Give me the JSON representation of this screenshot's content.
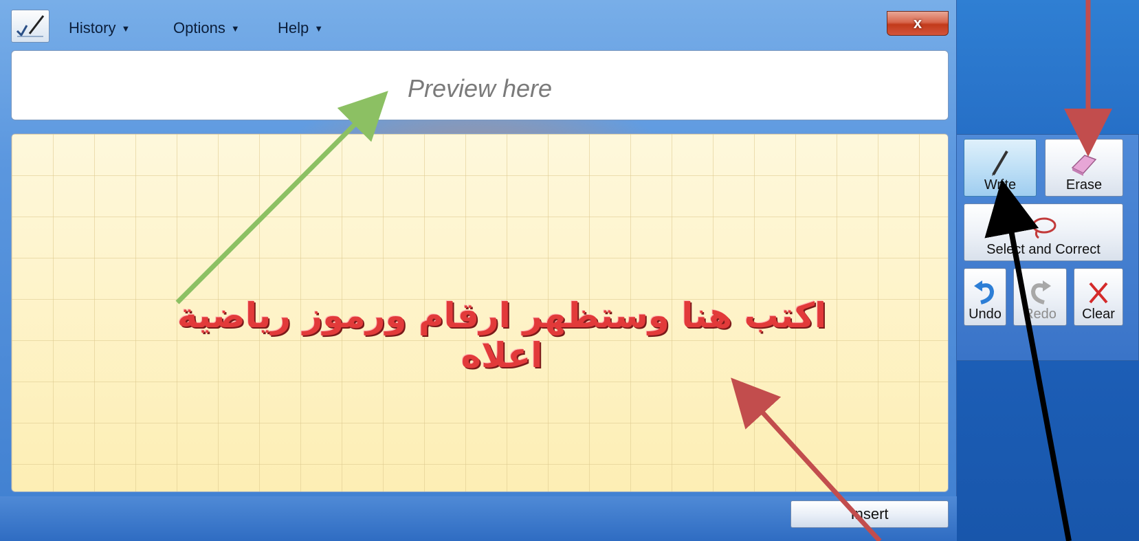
{
  "window": {
    "menu": [
      {
        "label": "History"
      },
      {
        "label": "Options"
      },
      {
        "label": "Help"
      }
    ],
    "close_label": "x"
  },
  "preview": {
    "placeholder": "Preview here"
  },
  "writing_pad": {
    "annotation_text": "اكتب هنا وستظهر ارقام ورموز رياضية اعلاه"
  },
  "tools": {
    "write_label": "Write",
    "erase_label": "Erase",
    "select_label": "Select and Correct",
    "undo_label": "Undo",
    "redo_label": "Redo",
    "clear_label": "Clear"
  },
  "insert_label": "Insert",
  "icons": {
    "app": "math-input-icon",
    "write": "pen-icon",
    "erase": "eraser-icon",
    "select": "lasso-icon",
    "undo": "undo-icon",
    "redo": "redo-icon",
    "clear": "x-icon"
  },
  "colors": {
    "pad_background": "#fdf3c4",
    "annotation_red": "#c24d4d",
    "annotation_green": "#8cc063",
    "annotation_black": "#000000",
    "close_button": "#c23a1b"
  }
}
